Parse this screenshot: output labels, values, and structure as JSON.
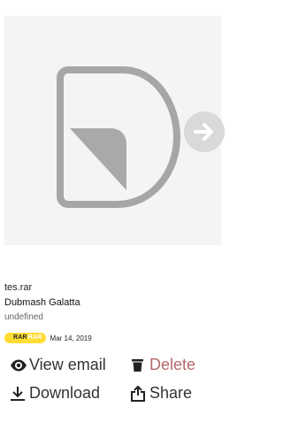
{
  "file": {
    "name": "tes.rar",
    "title": "Dubmash Galatta",
    "meta": "undefined",
    "badge_text": "RAR",
    "badge_ghost_text": "RAR",
    "date": "Mar 14, 2019"
  },
  "icons": {
    "file_glyph": "file-document-icon",
    "next": "arrow-right-icon",
    "view": "eye-icon",
    "delete": "trash-icon",
    "download": "download-icon",
    "share": "share-icon"
  },
  "actions": {
    "view_label": "View email",
    "delete_label": "Delete",
    "download_label": "Download",
    "share_label": "Share"
  },
  "colors": {
    "preview_bg": "#f4f4f4",
    "badge": "#ffdd33",
    "delete": "#b56a6a",
    "arrow_bg": "#d9d9d9"
  }
}
